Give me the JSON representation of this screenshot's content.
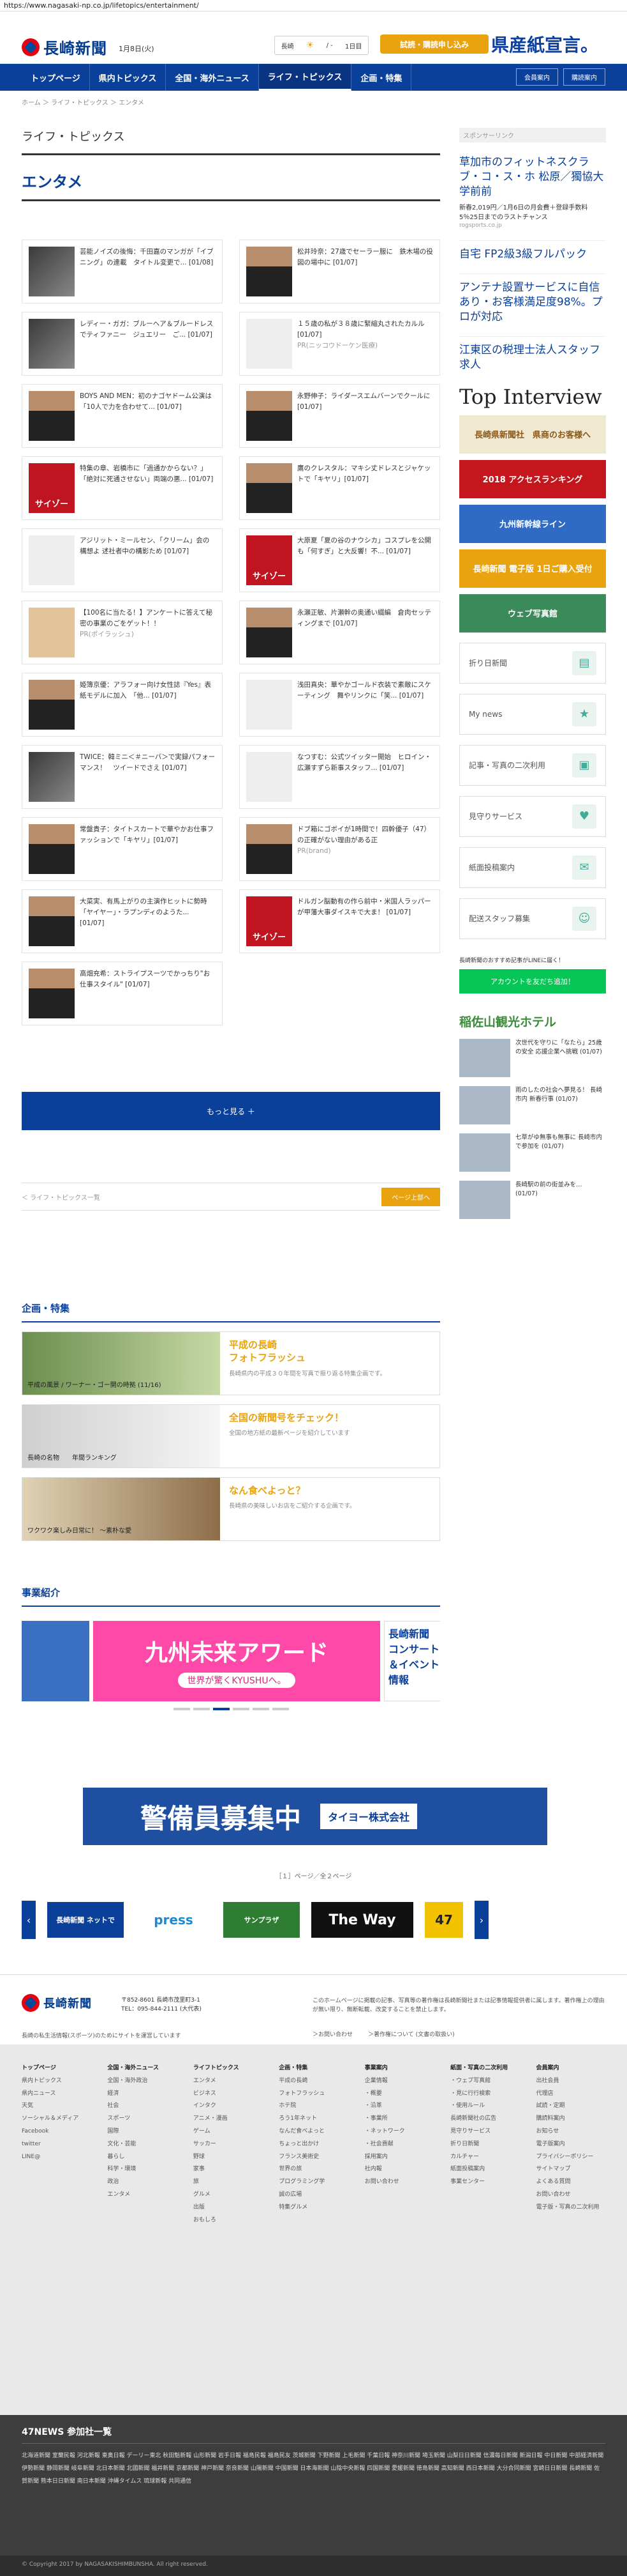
{
  "browser": {
    "url": "https://www.nagasaki-np.co.jp/lifetopics/entertainment/"
  },
  "header": {
    "logo_text": "長崎新聞",
    "date": "1月8日(火)",
    "weather": {
      "city": "長崎",
      "temp": "/ -",
      "link": "1日目"
    },
    "trial_button": "試読・購読申し込み",
    "ad_text": "県産紙宣言。"
  },
  "nav": {
    "items": [
      "トップページ",
      "県内トピックス",
      "全国・海外ニュース",
      "ライフ・トピックス",
      "企画・特集"
    ],
    "active": "ライフ・トピックス",
    "login": "会員案内",
    "sub": "購読案内"
  },
  "breadcrumb": "ホーム ＞ ライフ・トピックス ＞ エンタメ",
  "main": {
    "section_label": "ライフ・トピックス",
    "category_title": "エンタメ",
    "cards": [
      {
        "text": "芸能ノイズの後悔：千田嘉のマンガが「イブニング」の連載　タイトル変更で... [01/08]",
        "thumb": "magazine"
      },
      {
        "text": "松井玲奈：27歳でセーラー服に　鉄木場の役図の場中に [01/07]",
        "thumb": "face"
      },
      {
        "text": "レディー・ガガ：ブルーヘア＆ブルードレスでティファニー　ジュエリー　ご... [01/07]",
        "thumb": "magazine"
      },
      {
        "text": "１５歳の私が３８歳に緊縮丸されたカルル [01/07]",
        "thumb": "pale",
        "pr": "PR(ニッコウドーケン医療)"
      },
      {
        "text": "BOYS AND MEN：初のナゴヤドーム公演は「10人で力を合わせて... [01/07]",
        "thumb": "face"
      },
      {
        "text": "永野伸子：ライダースエムバーンでクールに [01/07]",
        "thumb": "face"
      },
      {
        "text": "特集の章、岩橋市に「過通かからない？」「絶対に死通させない」両端の悪... [01/07]",
        "thumb": "red"
      },
      {
        "text": "鷹のクレスタル：マキシ丈ドレスとジャケットで「キヤリ」[01/07]",
        "thumb": "face"
      },
      {
        "text": "アジリット・ミールセン、「クリーム」会の構想よ 述社者中の構影ため [01/07]",
        "thumb": "pale"
      },
      {
        "text": "大原夏「夏の谷のナウシカ」コスプレを公開も「何すぎ」と大反響！不... [01/07]",
        "thumb": "red"
      },
      {
        "text": "【100名に当たる！】アンケートに答えて秘密の事業のごをゲット！！",
        "thumb": "dog",
        "pr": "PR(ポイラッシュ)"
      },
      {
        "text": "永瀬正敏、片瀬幹の奥通い綴編　倉肉セッティングまで [01/07]",
        "thumb": "face"
      },
      {
        "text": "姫簿京優：アラフォー向け女性誌『Yes』表紙モデルに加入　「他... [01/07]",
        "thumb": "face"
      },
      {
        "text": "浅田真央：華やかゴールド衣装で素敵にスケーティング　舞やリンクに「笑... [01/07]",
        "thumb": "pale"
      },
      {
        "text": "TWICE：韓ミニ＜＃ニーバ＞で実録パフォーマンス！　ツイードでさえ [01/07]",
        "thumb": "magazine"
      },
      {
        "text": "なつすむ：公式ツイッター開始　ヒロイン・広瀬すずら新事スタッフ... [01/07]",
        "thumb": "pale"
      },
      {
        "text": "常盤貴子：タイトスカートで華やかお仕事ファッションで「キヤリ」[01/07]",
        "thumb": "face"
      },
      {
        "text": "ドブ箱にゴボイが1時間で！四幹優子（47）の正確がない理由がある正",
        "thumb": "face",
        "pr": "PR(brand)"
      },
      {
        "text": "大菜実、有馬上がりの主演作ヒットに勢時「ヤイヤー」・ラプンディのようた... [01/07]",
        "thumb": "face"
      },
      {
        "text": "ドルガン脳動有の作ら前中・米国人ラッパーが甲藩大事ダイスキで大ま！ [01/07]",
        "thumb": "red"
      },
      {
        "text": "高畑充希：ストライプスーツでかっちり\"お仕事スタイル\" [01/07]",
        "thumb": "face"
      }
    ],
    "more_label": "もっと見る ＋",
    "back_label": "＜ ライフ・トピックス一覧",
    "page_top": "ページ上部へ",
    "features_title": "企画・特集",
    "features": [
      {
        "img_caption": "平成の風景 / ワーナー・ゴー開の時拠 (11/16)",
        "title": "平成の長崎\nフォトフラッシュ",
        "desc": "長崎県内の平成３０年間を写真で振り返る特集企画です。"
      },
      {
        "img_caption": "長崎の名物　　年間ランキング",
        "title": "全国の新聞号をチェック！",
        "desc": "全国の地方紙の最新ページを紹介しています"
      },
      {
        "img_caption": "ワクワク楽しみ日常に！ 〜素朴な愛",
        "title": "なん食べよっと？",
        "desc": "長崎県の美味しいお店をご紹介する企画です。"
      }
    ],
    "business_title": "事業紹介",
    "carousel": [
      {
        "title": "九州未来アワード",
        "subtitle": "世界が驚くKYUSHUへ。"
      },
      {
        "title": "長崎新聞 コンサート＆イベント情報"
      }
    ]
  },
  "sidebar": {
    "sponsor_label": "スポンサーリンク",
    "ad1": {
      "title": "草加市のフィットネスクラブ・コ・ス・ホ 松原／獨協大学前前",
      "line": "新春2,019円／1月6日の月会費＋登録手数料5％25日までのラストチャンス",
      "url": "rogsports.co.jp"
    },
    "ad2": "自宅 FP2級3級フルパック",
    "ad3": "アンテナ設置サービスに自信あり・お客様満足度98%。プロが対応",
    "ad4": "江東区の税理士法人スタッフ求人",
    "interview_small": "TOP Interview",
    "interview_big": "Top Interview",
    "banners": [
      "長崎県新聞社　県商のお客様へ",
      "2018 アクセスランキング",
      "九州新幹線ライン",
      "長崎新聞 電子版 1日ご購入受付",
      "ウェブ写真館"
    ],
    "menu": [
      "折り日新聞",
      "My news",
      "記事・写真の二次利用",
      "見守りサービス",
      "紙面投稿案内",
      "配送スタッフ募集"
    ],
    "line_promo": "長崎新聞のおすすめ記事がLINEに届く！",
    "line_button": "アカウントを友だち追加！",
    "hotel": "稲佐山観光ホテル",
    "news": [
      "次世代を守りに「なたら」25歳の安全 応援企業へ挑戦 (01/07)",
      "雨のしたの社会へ夢見る！ 長崎市内 新春行事 (01/07)",
      "七草がゆ無事も無事に 長崎市内で参加を (01/07)",
      "長崎駅の前の街並みを… (01/07)"
    ]
  },
  "bottom": {
    "keibi_text": "警備員募集中",
    "keibi_company": "タイヨー株式会社",
    "page_indicator": "［１］ページ／全２ページ",
    "partners": [
      "長崎新聞 ネットで",
      "press",
      "サンプラザ",
      "The Way",
      "47"
    ],
    "footer_logo": "長崎新聞",
    "address": "〒852-8601 長崎市茂里町3-1\nTEL：095-844-2111 (大代表)",
    "note": "長崎の私生活情報(スポーツ)のためにサイトを運営しています",
    "copyright_note": "このホームページに掲載の記事、写真等の著作権は長崎新聞社または記事情報提供者に属します。著作権上の理由が無い限り、無断転載、改変することを禁止します。",
    "footer_links": [
      "＞お問い合わせ",
      "＞著作権について (文書の取扱い)"
    ],
    "sitemap": [
      {
        "head": "トップページ",
        "items": [
          "県内トピックス",
          "県内ニュース",
          "天気",
          "ソーシャル＆メディア",
          "Facebook",
          "twitter",
          "LINE@"
        ]
      },
      {
        "head": "全国・海外ニュース",
        "items": [
          "全国・海外政治",
          "経済",
          "社会",
          "スポーツ",
          "国際",
          "文化・芸能",
          "暮らし",
          "科学・環境",
          "政治",
          "エンタメ"
        ]
      },
      {
        "head": "ライフトピックス",
        "items": [
          "エンタメ",
          "ビジネス",
          "インタク",
          "アニメ・漫画",
          "ゲーム",
          "サッカー",
          "野球",
          "家事",
          "旅",
          "グルメ",
          "出版",
          "おもしろ"
        ]
      },
      {
        "head": "企画・特集",
        "items": [
          "平成の長崎",
          "フォトフラッシュ",
          "ホテ院",
          "ろう1年ネット",
          "なんだ食べよっと",
          "ちょっと出かけ",
          "フランス美術史",
          "世界の旅",
          "プログラミング学",
          "誠の広場",
          "特集グルメ"
        ]
      },
      {
        "head": "事業案内",
        "items": [
          "企業情報",
          "・概要",
          "・沿革",
          "・事業所",
          "・ネットワーク",
          "・社会貢献",
          "採用案内",
          "社内報",
          "お問い合わせ"
        ]
      },
      {
        "head": "紙面・写真の二次利用",
        "items": [
          "・ウェブ写真館",
          "・見に行行検索",
          "・使用ルール",
          "長崎新聞社の広告",
          "見守りサービス",
          "折り日新聞",
          "カルチャー",
          "紙面投稿案内",
          "事業センター"
        ]
      },
      {
        "head": "会員案内",
        "items": [
          "出社会員",
          "代理店",
          "試読・定期",
          "購読料案内",
          "お知らせ",
          "電子版案内",
          "プライバシーポリシー",
          "サイトマップ",
          "よくある質問",
          "お問い合わせ",
          "電子版・写真の二次利用"
        ]
      }
    ],
    "n47_title": "47NEWS 参加社一覧",
    "n47_list": "北海道新聞 室蘭民報 河北新報 東奥日報 デーリー東北 秋田魁新報 山形新聞 岩手日報 福島民報 福島民友 茨城新聞 下野新聞 上毛新聞 千葉日報 神奈川新聞 埼玉新聞 山梨日日新聞 信濃毎日新聞 新潟日報 中日新聞 中部経済新聞 伊勢新聞 静岡新聞 岐阜新聞 北日本新聞 北國新聞 福井新聞 京都新聞 神戸新聞 奈良新聞 山陽新聞 中国新聞 日本海新聞 山陰中央新報 四国新聞 愛媛新聞 徳島新聞 高知新聞 西日本新聞 大分合同新聞 宮崎日日新聞 長崎新聞 佐賀新聞 熊本日日新聞 南日本新聞 沖縄タイムス 琉球新報 共同通信",
    "copyright": "© Copyright 2017 by NAGASAKISHIMBUNSHA. All right reserved."
  },
  "colors": {
    "brand": "#0a3f9a",
    "accent": "#e8a30e",
    "red": "#e60012",
    "line": "#06c755"
  }
}
